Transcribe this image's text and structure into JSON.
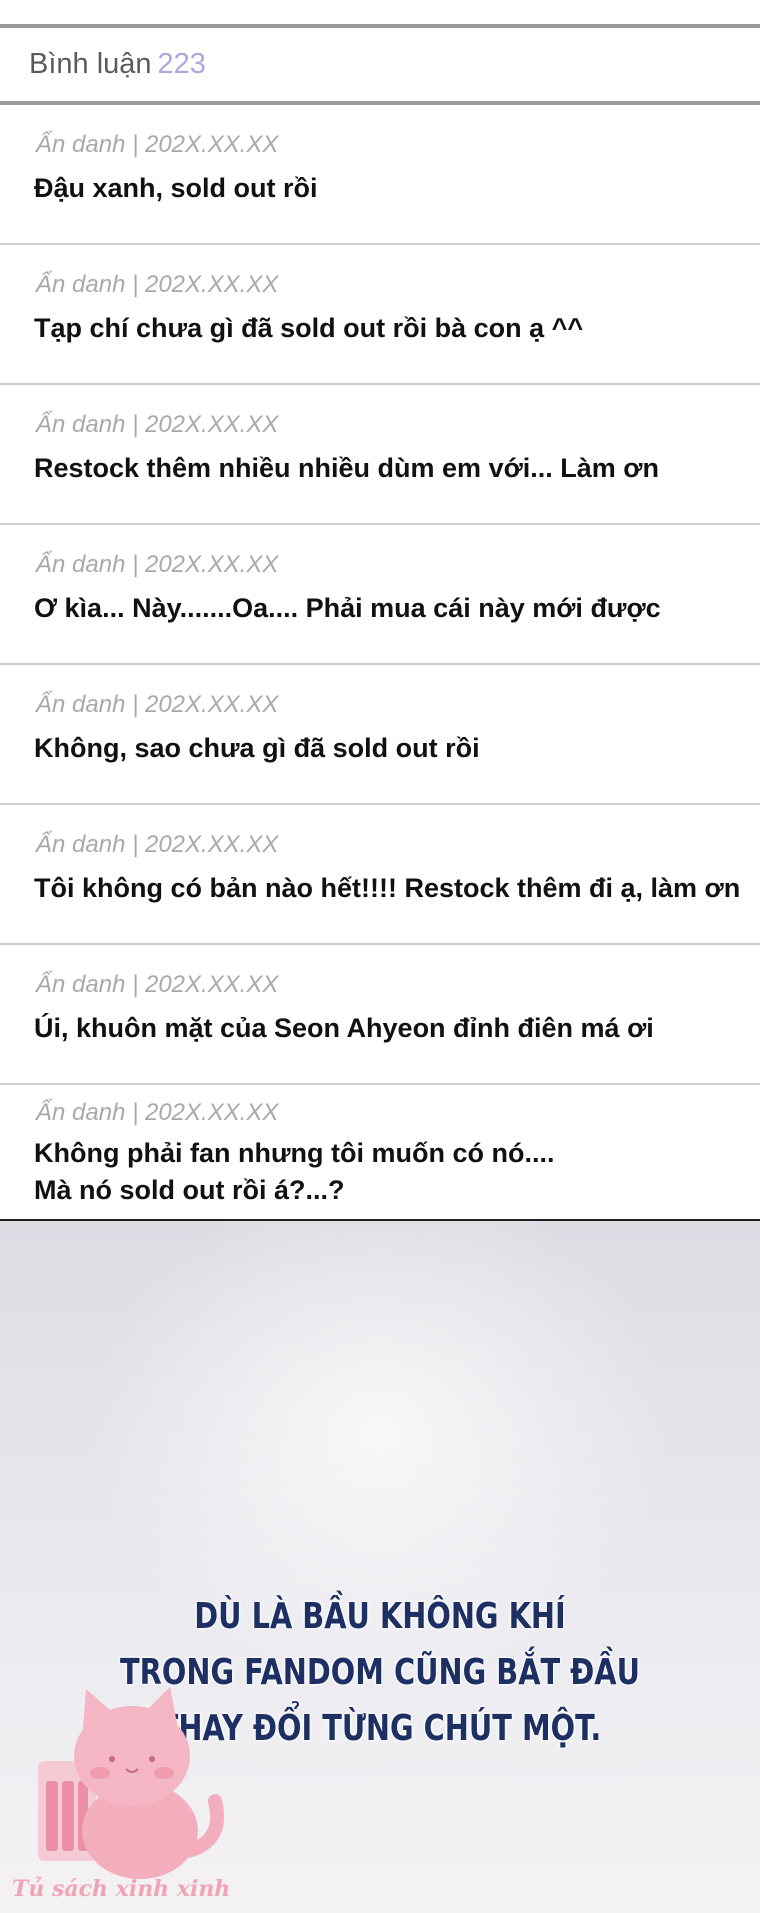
{
  "header": {
    "title": "Bình luận",
    "count": "223"
  },
  "comments": [
    {
      "meta": "Ẩn danh | 202X.XX.XX",
      "text": "Đậu xanh, sold out rồi"
    },
    {
      "meta": "Ẩn danh | 202X.XX.XX",
      "text": "Tạp chí chưa gì đã sold out rồi bà con ạ ^^"
    },
    {
      "meta": "Ẩn danh | 202X.XX.XX",
      "text": "Restock thêm nhiều nhiều dùm em với... Làm ơn"
    },
    {
      "meta": "Ẩn danh | 202X.XX.XX",
      "text": "Ơ kìa... Này.......Oa.... Phải mua cái này mới được"
    },
    {
      "meta": "Ẩn danh | 202X.XX.XX",
      "text": "Không, sao chưa gì đã sold out rồi"
    },
    {
      "meta": "Ẩn danh | 202X.XX.XX",
      "text": "Tôi không có bản nào hết!!!! Restock thêm đi ạ, làm ơn"
    },
    {
      "meta": "Ẩn danh | 202X.XX.XX",
      "text": "Úi, khuôn mặt của Seon Ahyeon đỉnh điên má ơi"
    },
    {
      "meta": "Ẩn danh | 202X.XX.XX",
      "text_line1": "Không phải fan nhưng tôi muốn có nó....",
      "text_line2": "Mà nó sold out rồi á?...?"
    }
  ],
  "caption": {
    "line1": "DÙ LÀ BẦU KHÔNG KHÍ",
    "line2": "TRONG FANDOM CŨNG BẮT ĐẦU",
    "line3": "THAY ĐỔI TỪNG CHÚT MỘT."
  },
  "watermark": {
    "text": "Tủ sách xinh xinh",
    "icon": "pink-cat-books-logo"
  },
  "colors": {
    "count_accent": "#a8a9dd",
    "caption_text": "#1d2f63",
    "watermark_pink": "#f0a4b6"
  }
}
